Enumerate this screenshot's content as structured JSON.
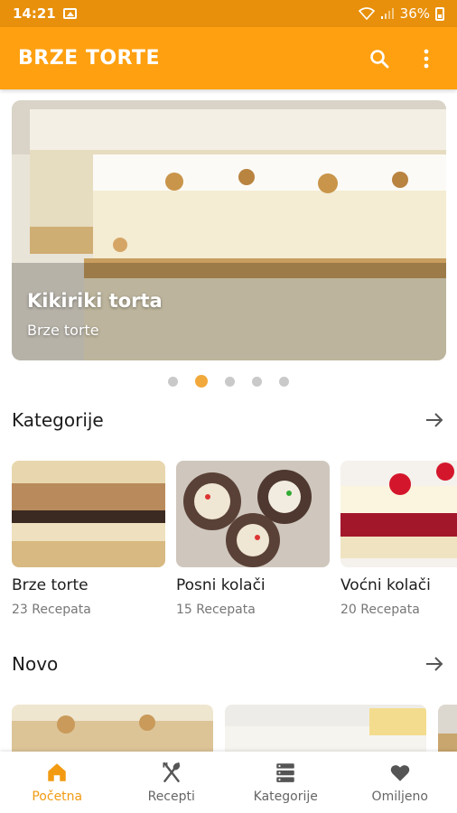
{
  "status": {
    "time": "14:21",
    "battery": "36%"
  },
  "app_bar": {
    "title": "BRZE TORTE",
    "icons": [
      "search-icon",
      "more-vert-icon"
    ]
  },
  "colors": {
    "primary": "#ffa010",
    "status_bar": "#e8900b",
    "active_nav": "#f29b12",
    "dot_active": "#f2a93b"
  },
  "hero": {
    "title": "Kikiriki torta",
    "subtitle": "Brze torte",
    "slides": 5,
    "active_slide": 2
  },
  "categories": {
    "title": "Kategorije",
    "items": [
      {
        "name": "Brze torte",
        "count": "23 Recepata"
      },
      {
        "name": "Posni kolači",
        "count": "15 Recepata"
      },
      {
        "name": "Voćni kolači",
        "count": "20 Recepata"
      }
    ]
  },
  "new_section": {
    "title": "Novo"
  },
  "bottom_nav": {
    "items": [
      {
        "label": "Početna",
        "icon": "home-icon",
        "active": true
      },
      {
        "label": "Recepti",
        "icon": "utensils-icon",
        "active": false
      },
      {
        "label": "Kategorije",
        "icon": "list-icon",
        "active": false
      },
      {
        "label": "Omiljeno",
        "icon": "heart-icon",
        "active": false
      }
    ]
  }
}
